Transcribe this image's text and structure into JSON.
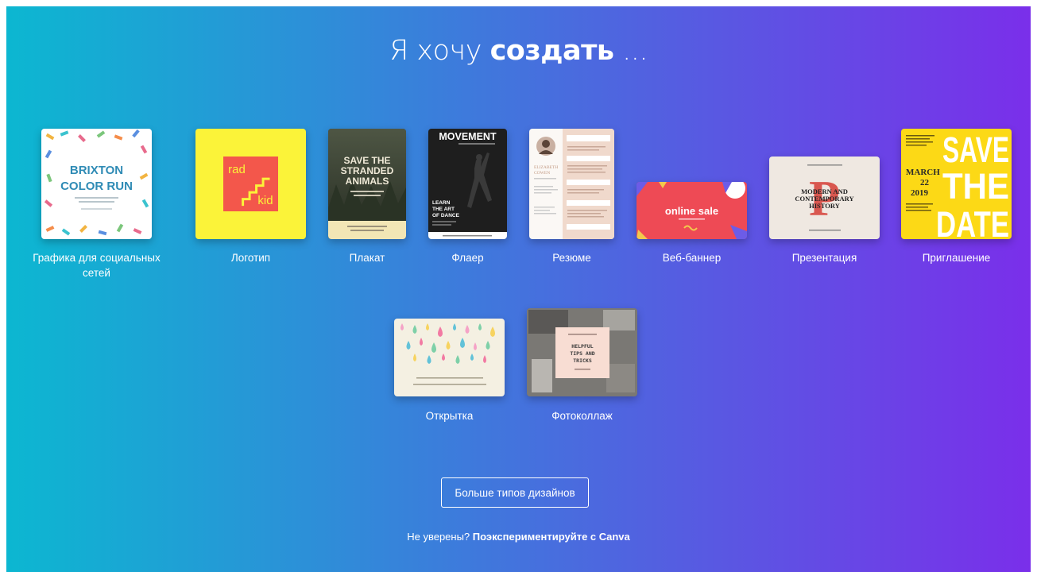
{
  "heading": {
    "prefix": "Я хочу",
    "bold": "создать",
    "suffix": "..."
  },
  "design_types": [
    {
      "label": "Графика для социальных сетей",
      "thumb_text": [
        "BRIXTON",
        "COLOR RUN"
      ]
    },
    {
      "label": "Логотип",
      "thumb_text": [
        "rad",
        "kid"
      ]
    },
    {
      "label": "Плакат",
      "thumb_text": [
        "SAVE THE",
        "STRANDED",
        "ANIMALS"
      ]
    },
    {
      "label": "Флаер",
      "thumb_text": [
        "MOVEMENT",
        "LEARN",
        "THE ART",
        "OF DANCE"
      ]
    },
    {
      "label": "Резюме",
      "thumb_text": [
        "ELIZABETH",
        "COWEN"
      ]
    },
    {
      "label": "Веб-баннер",
      "thumb_text": [
        "online sale"
      ]
    },
    {
      "label": "Презентация",
      "thumb_text": [
        "MODERN AND",
        "CONTEMPORARY",
        "HISTORY"
      ]
    },
    {
      "label": "Приглашение",
      "thumb_text": [
        "SAVE",
        "THE",
        "DATE",
        "MARCH",
        "22",
        "2019"
      ]
    },
    {
      "label": "Открытка",
      "thumb_text": []
    },
    {
      "label": "Фотоколлаж",
      "thumb_text": [
        "HELPFUL",
        "TIPS AND",
        "TRICKS"
      ]
    }
  ],
  "more_button": "Больше типов дизайнов",
  "footer": {
    "question": "Не уверены?",
    "link": "Поэкспериментируйте с Canva"
  },
  "colors": {
    "gradient_start": "#0cb7d1",
    "gradient_end": "#7a2fea"
  }
}
